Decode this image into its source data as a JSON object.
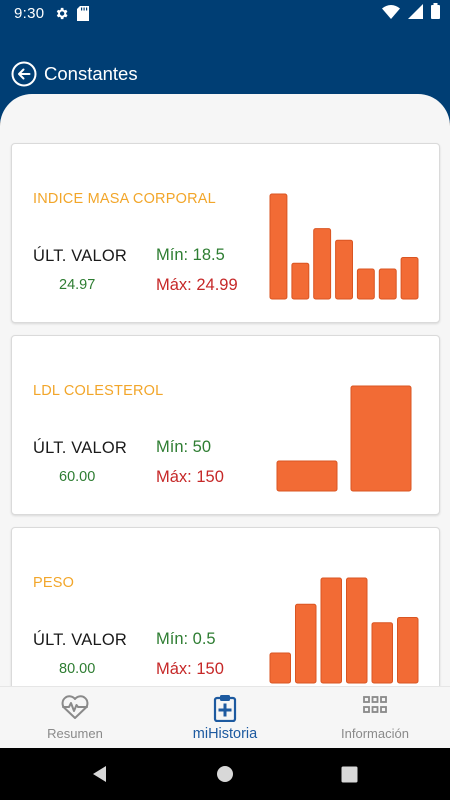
{
  "status_bar": {
    "time": "9:30",
    "icons": [
      "gear-icon",
      "sd-card-icon",
      "wifi-icon",
      "signal-icon",
      "battery-icon"
    ]
  },
  "app_bar": {
    "title": "Constantes",
    "back_icon": "back-arrow-circle-icon",
    "background_color": "#003e74"
  },
  "cards": [
    {
      "title": "INDICE MASA CORPORAL",
      "ult_label": "ÚLT. VALOR",
      "ult_value": "24.97",
      "min_text": "Mín: 18.5",
      "max_text": "Máx: 24.99",
      "bar_values": [
        25.0,
        19.0,
        22.0,
        21.0,
        18.5,
        18.5,
        19.5
      ]
    },
    {
      "title": "LDL COLESTEROL",
      "ult_label": "ÚLT. VALOR",
      "ult_value": "60.00",
      "min_text": "Mín: 50",
      "max_text": "Máx: 150",
      "bar_values": [
        50,
        150
      ]
    },
    {
      "title": "PESO",
      "ult_label": "ÚLT. VALOR",
      "ult_value": "80.00",
      "min_text": "Mín: 0.5",
      "max_text": "Máx: 150",
      "bar_values": [
        45,
        82,
        102,
        102,
        68,
        72
      ]
    }
  ],
  "colors": {
    "accent_orange": "#f26b35",
    "title_yellow": "#f2a62a",
    "min_green": "#2e7d32",
    "max_red": "#c62828",
    "nav_active": "#1d5aa0"
  },
  "bottom_nav": {
    "items": [
      {
        "label": "Resumen",
        "icon": "heart-pulse-icon",
        "active": false
      },
      {
        "label": "miHistoria",
        "icon": "medical-clipboard-icon",
        "active": true
      },
      {
        "label": "Información",
        "icon": "grid-dots-icon",
        "active": false
      }
    ]
  },
  "system_nav": {
    "buttons": [
      "back-triangle-icon",
      "home-circle-icon",
      "recents-square-icon"
    ]
  }
}
